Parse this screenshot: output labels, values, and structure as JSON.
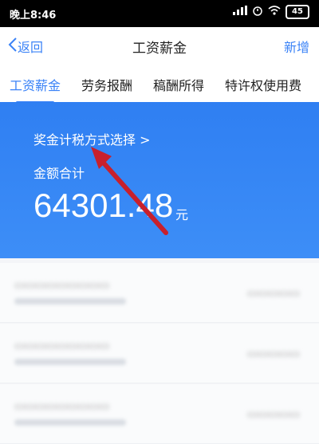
{
  "status": {
    "time": "晚上8:46",
    "battery": "45"
  },
  "nav": {
    "back_label": "返回",
    "title": "工资薪金",
    "add_label": "新增"
  },
  "tabs": [
    {
      "label": "工资薪金",
      "active": true
    },
    {
      "label": "劳务报酬"
    },
    {
      "label": "稿酬所得"
    },
    {
      "label": "特许权使用费"
    }
  ],
  "summary": {
    "method_link": "奖金计税方式选择 >",
    "total_label": "金额合计",
    "total_amount": "64301.48",
    "unit": "元"
  },
  "colors": {
    "accent": "#3b83f7",
    "hero": "#3d8ef7",
    "arrow": "#c8202c"
  }
}
